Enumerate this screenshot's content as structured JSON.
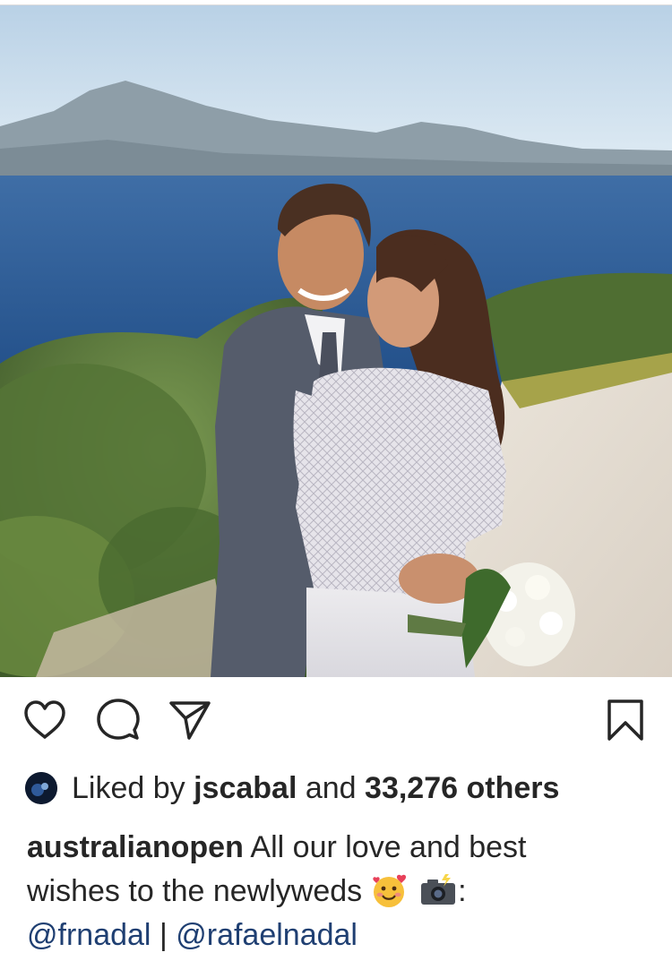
{
  "post": {
    "liked_by": {
      "prefix": "Liked by",
      "user": "jscabal",
      "conjunction": "and",
      "others": "33,276 others"
    },
    "caption": {
      "username": "australianopen",
      "text_line1": "All our love and best",
      "text_line2": "wishes to the newlyweds",
      "photo_credit_separator": ":",
      "mention_1": "@frnadal",
      "divider": "|",
      "mention_2": "@rafaelnadal",
      "emojis": [
        "smiling-face-with-hearts-icon",
        "camera-with-flash-icon"
      ]
    }
  },
  "actions": {
    "icons": [
      "heart-icon",
      "comment-icon",
      "share-icon",
      "bookmark-icon"
    ]
  },
  "colors": {
    "text": "#262626",
    "mention": "#1f3f72",
    "sky": "#cfe1ee",
    "sea": "#2d5b93",
    "foliage": "#5c7a3a"
  }
}
